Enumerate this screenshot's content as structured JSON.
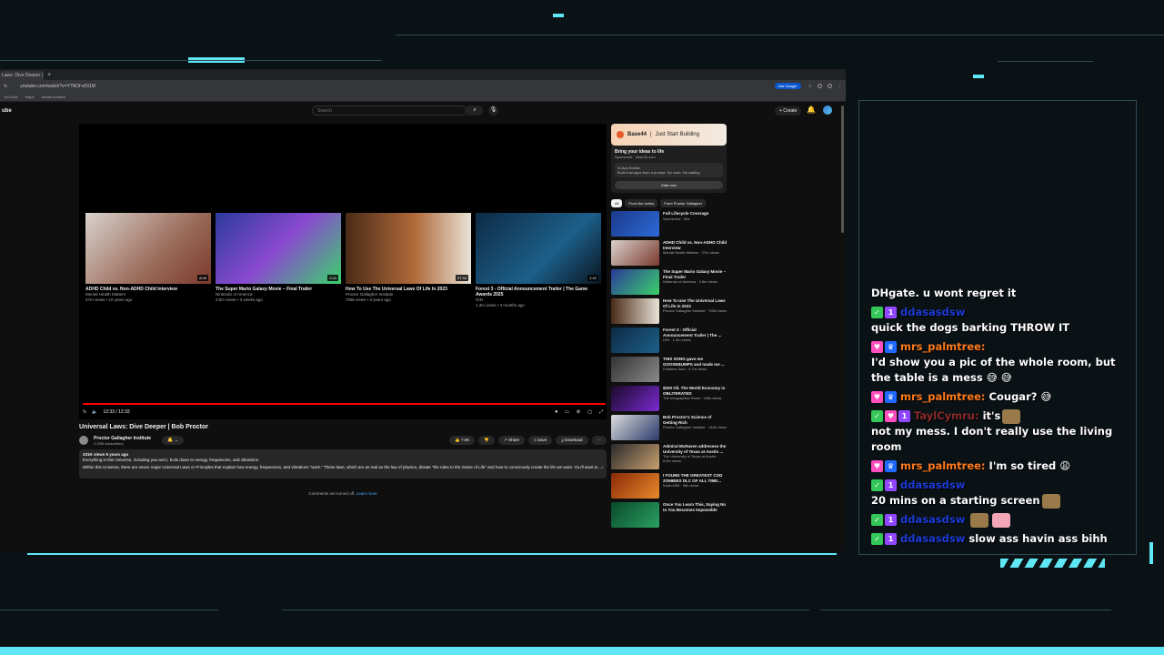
{
  "browser": {
    "tab_title": "Laws: Dive Deeper | ",
    "url": "youtube.com/watch?v=Y7NOf-eDt1M",
    "ask_google": "Ask Google",
    "bookmarks": [
      "YouTube",
      "Maps",
      "Adobe Acrobat"
    ]
  },
  "youtube": {
    "logo": "ube",
    "search_placeholder": "Search",
    "create_label": "+ Create",
    "video": {
      "time": "12:33 / 12:33",
      "title": "Universal Laws: Dive Deeper | Bob Proctor",
      "channel": "Proctor Gallagher Institute",
      "subscribers": "2.29M subscribers",
      "likes": "7.6K",
      "share": "Share",
      "save": "Save",
      "download": "Download",
      "desc_meta": "231K views  6 years ago",
      "desc_line1": "Everything in this Universe, including you and I, boils down to energy, frequencies, and vibrations.",
      "desc_line2": "Within this Universe, there are seven major Universal Laws or Principles that explain how energy, frequencies, and vibrations \"work.\" These laws, which are as real as the law of physics, dictate \"the rules to the Game of Life\" and how to consciously create the life we want. You'll want to  ...more",
      "comments_off": "Comments are turned off.",
      "learn_more": "Learn more"
    },
    "endcards": [
      {
        "title": "ADHD Child vs. Non-ADHD Child Interview",
        "channel": "Mental Health Matters",
        "meta": "27m views • 10 years ago",
        "dur": "8:49",
        "bg": "linear-gradient(135deg,#d9d2cc,#9a6b5a 60%,#7b3a2e)"
      },
      {
        "title": "The Super Mario Galaxy Movie – Final Trailer",
        "channel": "Nintendo of America",
        "meta": "3.8m views • 3 weeks ago",
        "dur": "2:24",
        "bg": "linear-gradient(135deg,#2a3a9a,#8a4ad1 50%,#3bd16a)"
      },
      {
        "title": "How To Use The Universal Laws Of Life In 2023",
        "channel": "Proctor Gallagher Institute",
        "meta": "705k views • 3 years ago",
        "dur": "57:46",
        "bg": "linear-gradient(90deg,#4a2b18,#b06a3a 55%,#e9e2d6)"
      },
      {
        "title": "Forest 3 - Official Announcement Trailer | The Game Awards 2025",
        "channel": "IGN",
        "meta": "1.3m views • 3 months ago",
        "dur": "1:42",
        "bg": "linear-gradient(135deg,#0d2b45,#1d5f8a 60%,#0a1620)"
      }
    ],
    "ad": {
      "brand": "Base44",
      "tagline": "Just Start Building",
      "headline": "Bring your ideas to life",
      "sponsor": "Sponsored · base44.com",
      "app": "AI App Builder",
      "app_desc": "Build real apps from a prompt. No code. No waiting.",
      "cta": "Start now"
    },
    "chips": [
      "All",
      "From the series",
      "From Proctor Gallagher"
    ],
    "recs": [
      {
        "title": "Full Lifecycle Coverage",
        "meta": "Sponsored · Wiz",
        "bg": "linear-gradient(135deg,#1a3a8a,#2e6ad8)"
      },
      {
        "title": "ADHD Child vs. Non-ADHD Child Interview",
        "meta": "Mental Health Matters · 27m views",
        "bg": "linear-gradient(135deg,#d9d2cc,#7b3a2e)"
      },
      {
        "title": "The Super Mario Galaxy Movie – Final Trailer",
        "meta": "Nintendo of America · 3.8m views",
        "bg": "linear-gradient(135deg,#2a3a9a,#3bd16a)"
      },
      {
        "title": "How To Use The Universal Laws Of Life In 2023",
        "meta": "Proctor Gallagher Institute · 705k views",
        "bg": "linear-gradient(90deg,#4a2b18,#e9e2d6)"
      },
      {
        "title": "Forest 3 - Official Announcement Trailer | The ...",
        "meta": "IGN · 1.3m views",
        "bg": "linear-gradient(135deg,#0d2b45,#1d5f8a)"
      },
      {
        "title": "THIS SONG gave me GOOSEBUMPS and made me ...",
        "meta": "Fearless Soul · 4.7m views",
        "bg": "linear-gradient(135deg,#333,#8a8a8a)"
      },
      {
        "title": "$200 Oil. The World Economy is OBLITERATED",
        "meta": "The Infographics Show · 446k views",
        "bg": "linear-gradient(135deg,#1a0a2a,#7a2ad1)"
      },
      {
        "title": "Bob Proctor's Science of Getting Rich",
        "meta": "Proctor Gallagher Institute · 146k views",
        "bg": "linear-gradient(135deg,#ddd,#2a3a6a)"
      },
      {
        "title": "Admiral McRaven addresses the University of Texas at Austin ...",
        "meta": "The University of Texas at Austin · 8.8m views",
        "bg": "linear-gradient(135deg,#2a2a2a,#c8a070)"
      },
      {
        "title": "I FOUND THE GREATEST COD ZOMBIES DLC OF ALL TIME...",
        "meta": "NoahJ456 · 56k views",
        "bg": "linear-gradient(135deg,#8a2a0a,#e98a2a)"
      },
      {
        "title": "Once You Learn This, Saying No to You Becomes Impossible",
        "meta": "",
        "bg": "linear-gradient(135deg,#0a4a2a,#2aa060)"
      }
    ]
  },
  "chat": [
    {
      "badges": [],
      "user": "",
      "ucolor": "",
      "text": "DHgate. u wont regret it"
    },
    {
      "badges": [
        "green",
        "purple"
      ],
      "user": "ddasasdsw",
      "ucolor": "blue",
      "text": "quick the dogs barking THROW IT"
    },
    {
      "badges": [
        "pink",
        "blue"
      ],
      "user": "mrs_palmtree:",
      "ucolor": "orange",
      "text": "I'd show you a pic of the whole room, but the table is a mess 😅 😅"
    },
    {
      "badges": [
        "pink",
        "blue"
      ],
      "user": "mrs_palmtree:",
      "ucolor": "orange",
      "text": "Cougar? 😅"
    },
    {
      "badges": [
        "green",
        "pink",
        "purple"
      ],
      "user": "TaylCymru:",
      "ucolor": "maroon",
      "text": "it's [emote] not my mess. I don't really use the living room"
    },
    {
      "badges": [
        "pink",
        "blue"
      ],
      "user": "mrs_palmtree:",
      "ucolor": "orange",
      "text": "I'm so tired 😩"
    },
    {
      "badges": [
        "green",
        "purple"
      ],
      "user": "ddasasdsw",
      "ucolor": "blue",
      "text": "20 mins on a starting screen [emote]"
    },
    {
      "badges": [
        "green",
        "purple"
      ],
      "user": "ddasasdsw",
      "ucolor": "blue",
      "text": "[emote] [emote]"
    },
    {
      "badges": [
        "green",
        "purple"
      ],
      "user": "ddasasdsw",
      "ucolor": "blue",
      "text": "slow ass havin ass bihh"
    }
  ]
}
